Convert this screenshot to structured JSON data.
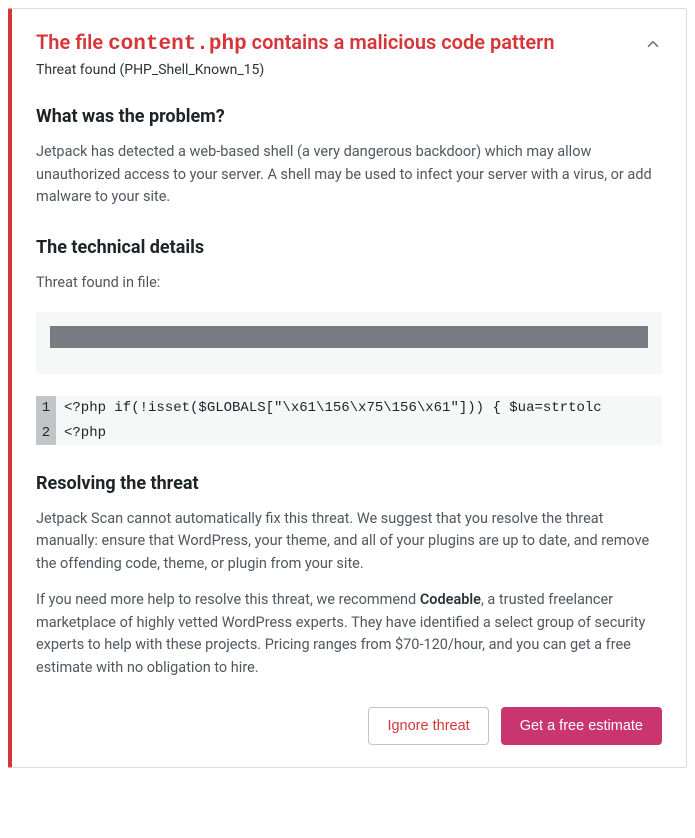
{
  "header": {
    "title_prefix": "The file ",
    "filename": "content.php",
    "title_suffix": " contains a malicious code pattern",
    "subtitle": "Threat found (PHP_Shell_Known_15)"
  },
  "sections": {
    "problem": {
      "heading": "What was the problem?",
      "body": "Jetpack has detected a web-based shell (a very dangerous backdoor) which may allow unauthorized access to your server. A shell may be used to infect your server with a virus, or add malware to your site."
    },
    "technical": {
      "heading": "The technical details",
      "found_in": "Threat found in file:",
      "code": {
        "line1_num": "1",
        "line1": "<?php if(!isset($GLOBALS[\"\\x61\\156\\x75\\156\\x61\"])) { $ua=strtolc",
        "line2_num": "2",
        "line2": "<?php"
      }
    },
    "resolving": {
      "heading": "Resolving the threat",
      "body1": "Jetpack Scan cannot automatically fix this threat. We suggest that you resolve the threat manually: ensure that WordPress, your theme, and all of your plugins are up to date, and remove the offending code, theme, or plugin from your site.",
      "body2_pre": "If you need more help to resolve this threat, we recommend ",
      "body2_bold": "Codeable",
      "body2_post": ", a trusted freelancer marketplace of highly vetted WordPress experts. They have identified a select group of security experts to help with these projects. Pricing ranges from $70-120/hour, and you can get a free estimate with no obligation to hire."
    }
  },
  "actions": {
    "ignore": "Ignore threat",
    "estimate": "Get a free estimate"
  }
}
